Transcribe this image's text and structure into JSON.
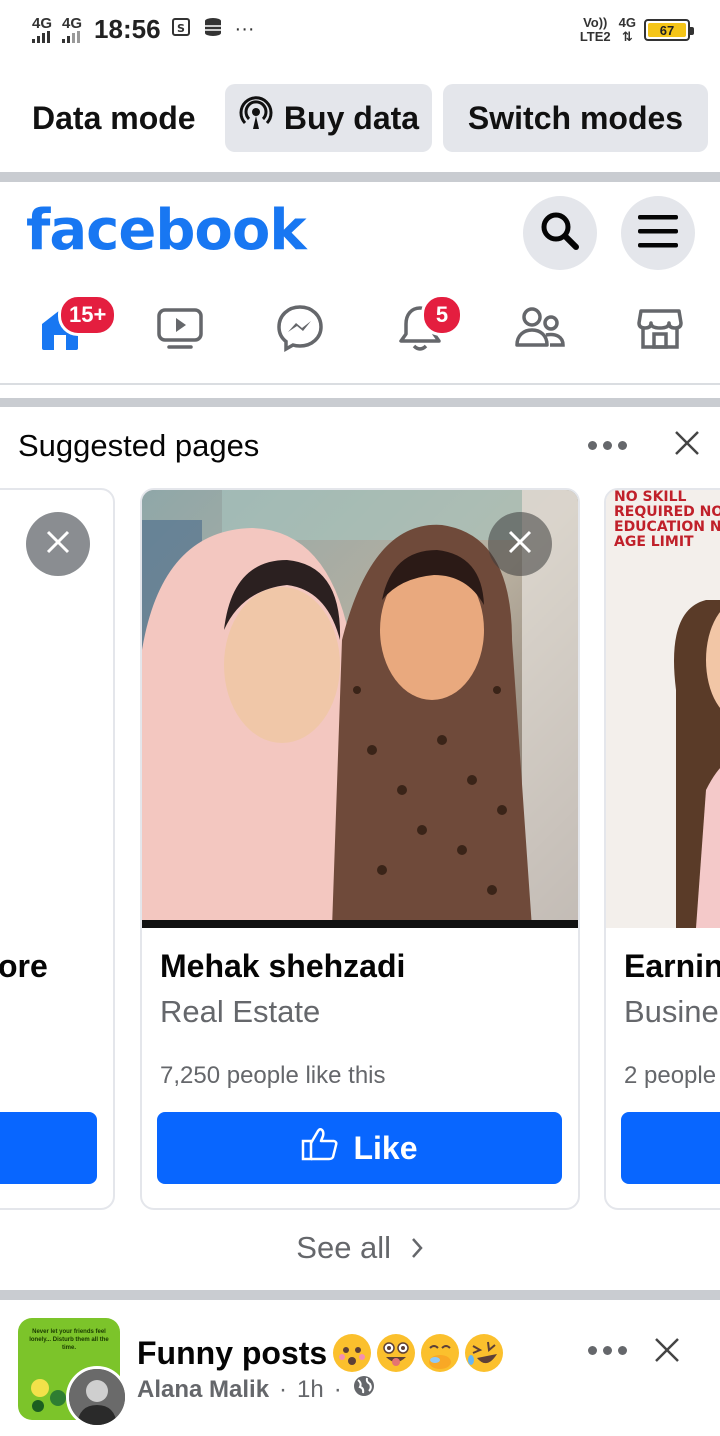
{
  "status_bar": {
    "signal1": "4G",
    "signal2": "4G",
    "time": "18:56",
    "extra": "···",
    "volte_top": "Vo))",
    "volte_bottom": "LTE2",
    "net_top": "4G",
    "battery": "67"
  },
  "data_mode": {
    "label": "Data mode",
    "buy_label": "Buy data",
    "switch_label": "Switch modes"
  },
  "header": {
    "logo": "facebook",
    "search_icon": "search-icon",
    "menu_icon": "hamburger-menu-icon"
  },
  "nav": {
    "home_badge": "15+",
    "notifications_badge": "5",
    "icons": [
      "home-icon",
      "video-icon",
      "messenger-icon",
      "bell-icon",
      "friends-icon",
      "marketplace-icon"
    ]
  },
  "suggested": {
    "title": "Suggested pages",
    "cards": [
      {
        "name": "ore"
      },
      {
        "name": "Mehak shehzadi",
        "category": "Real Estate",
        "likes": "7,250 people like this",
        "like_label": "Like"
      },
      {
        "name": "Earnin",
        "category": "Busine",
        "likes": "2 people",
        "banner": "NO SKILL REQUIRED NO EDUCATION NO AGE LIMIT"
      }
    ],
    "see_all": "See all"
  },
  "post": {
    "title": "Funny posts",
    "author": "Alana Malik",
    "time": "1h",
    "thumb_text": "Never let your friends feel lonely... Disturb them all the time."
  },
  "colors": {
    "brand": "#1877f2",
    "button": "#0866ff",
    "badge": "#e41e3f"
  }
}
